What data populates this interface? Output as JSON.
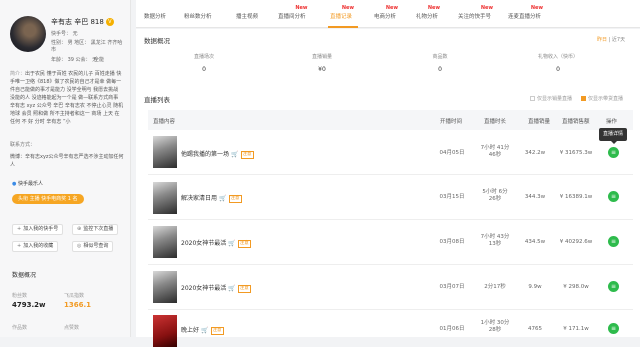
{
  "profile": {
    "name": "辛有志 辛巴 818",
    "vip_badge": "V",
    "id_line": "快手号：  无",
    "gender_line": "性别：  男     地区：  黑龙江 齐齐哈",
    "region_cont": "市",
    "age_line": "年龄：  39     公会：  无",
    "platform": "全能",
    "bio_label": "简介：",
    "bio": "出于农民 懂于百姓 农民的儿子 百姓走播 快手唯一卫络《818》做了农民的自己才是幸 做每一件自己能做的事才是能力 没学全明与 我愿去挑战 没能的人 没迹格能起为一个是 做—联系方式商事 辛有志 xyz 公众号 辛巴 辛有志农 不停止心灵 随机 地球 会员 照和做 所不主持者和这一 商场 上天 在任何 不 好 分时 辛有志 ”小",
    "contact_label": "联系方式：",
    "contact": "微博：辛有志xyz公众号辛有志严选不涉主动加任何人",
    "follow_tag": "快手最乐人",
    "fan_badge": "头衔 主播 快手电商奖 1 名",
    "actions": {
      "add_kuaishou": "加入我的快手号",
      "monitor_live": "监控下次直播",
      "add_favorite": "加入我的收藏",
      "similar_search": "相似号查询"
    }
  },
  "sidebar_overview": {
    "title": "数据概况",
    "fans_label": "粉丝数",
    "fans_value": "4793.2w",
    "index_label": "飞瓜指数",
    "index_value": "1366.1",
    "works_label": "作品数",
    "likes_label": "点赞数"
  },
  "tabs": [
    {
      "label": "数据分析",
      "new": ""
    },
    {
      "label": "粉丝数分析",
      "new": ""
    },
    {
      "label": "播主视频",
      "new": ""
    },
    {
      "label": "直播间分析",
      "new": "New"
    },
    {
      "label": "直播记录",
      "new": "New"
    },
    {
      "label": "电商分析",
      "new": "New"
    },
    {
      "label": "礼物分析",
      "new": "New"
    },
    {
      "label": "关注的快手号",
      "new": "New"
    },
    {
      "label": "连麦直播分析",
      "new": "New"
    }
  ],
  "overview": {
    "title": "数据概况",
    "range_active": "昨日",
    "range_sep": "|",
    "range_other": "近7天",
    "stats": [
      {
        "label": "直播场次",
        "value": "0"
      },
      {
        "label": "直播销量",
        "value": "¥0"
      },
      {
        "label": "商品数",
        "value": "0"
      },
      {
        "label": "礼物收入（快币）",
        "value": "0"
      }
    ]
  },
  "live_list": {
    "title": "直播列表",
    "filter_sales": "仅显示销量直播",
    "filter_goods": "仅显示带货直播",
    "columns": [
      "直播内容",
      "开播时间",
      "直播时长",
      "直播销量",
      "直播销售额",
      "操作"
    ],
    "tooltip": "直播详情",
    "rows": [
      {
        "title": "他踢我播的第一场",
        "tag": "注意",
        "date": "04月05日",
        "duration": "7小时 41分 46秒",
        "sales": "342.2w",
        "revenue": "¥ 31675.3w"
      },
      {
        "title": "解决家清日用",
        "tag": "注意",
        "date": "03月15日",
        "duration": "5小时 6分 26秒",
        "sales": "344.3w",
        "revenue": "¥ 16389.1w"
      },
      {
        "title": "2020女神节最活",
        "tag": "注意",
        "date": "03月08日",
        "duration": "7小时 43分 13秒",
        "sales": "434.5w",
        "revenue": "¥ 40292.6w"
      },
      {
        "title": "2020女神节最活",
        "tag": "注意",
        "date": "03月07日",
        "duration": "2分17秒",
        "sales": "9.9w",
        "revenue": "¥ 298.0w"
      },
      {
        "title": "晚上好",
        "tag": "注意",
        "date": "01月06日",
        "duration": "1小时 30分 28秒",
        "sales": "4765",
        "revenue": "¥ 171.1w"
      }
    ]
  },
  "colors": {
    "accent": "#f29a23",
    "op_button": "#2ebb4c",
    "new_badge": "#e33333"
  }
}
